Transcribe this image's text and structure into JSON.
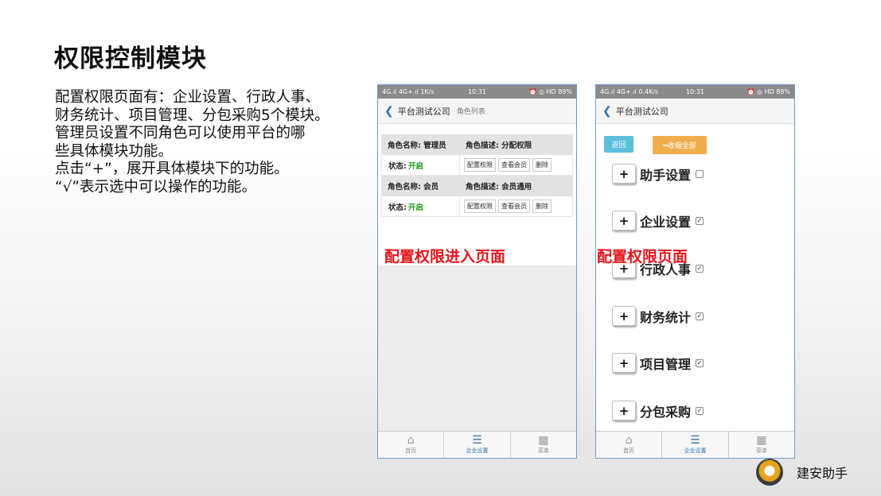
{
  "slide": {
    "title": "权限控制模块",
    "lines": [
      "配置权限页面有：企业设置、行政人事、",
      "财务统计、项目管理、分包采购5个模块。",
      "管理员设置不同角色可以使用平台的哪",
      "些具体模块功能。",
      "点击“+”，展开具体模块下的功能。",
      "“√”表示选中可以操作的功能。"
    ]
  },
  "status_bar": {
    "left": "4G.ıl 4G+.ıl 1K/s",
    "left2": "4G.ıl 4G+.ıl 0.4K/s",
    "time": "10:31",
    "right": "⏰ ◎ HD 89%"
  },
  "phone1": {
    "nav_title": "平台测试公司",
    "nav_sub": "角色列表",
    "roles": [
      {
        "name": "角色名称: 管理员",
        "desc": "角色描述: 分配权限",
        "status_label": "状态:",
        "status_value": "开启",
        "actions": [
          "配置权限",
          "查看会员",
          "删除"
        ]
      },
      {
        "name": "角色名称: 会员",
        "desc": "角色描述: 会员通用",
        "status_label": "状态:",
        "status_value": "开启",
        "actions": [
          "配置权限",
          "查看会员",
          "删除"
        ]
      }
    ],
    "caption": "配置权限进入页面"
  },
  "phone2": {
    "nav_title": "平台测试公司",
    "back_label": "返回",
    "collapse_label": "━收缩全部",
    "modules": [
      {
        "label": "助手设置",
        "checked": false
      },
      {
        "label": "企业设置",
        "checked": true
      },
      {
        "label": "行政人事",
        "checked": true
      },
      {
        "label": "财务统计",
        "checked": true
      },
      {
        "label": "项目管理",
        "checked": true
      },
      {
        "label": "分包采购",
        "checked": true
      }
    ],
    "caption": "配置权限页面"
  },
  "tabbar": {
    "tabs": [
      {
        "label": "首页",
        "icon": "home-icon"
      },
      {
        "label": "企业设置",
        "icon": "sliders-icon"
      },
      {
        "label": "菜单",
        "icon": "grid-icon"
      }
    ],
    "active": 1
  },
  "brand": {
    "name": "建安助手"
  }
}
